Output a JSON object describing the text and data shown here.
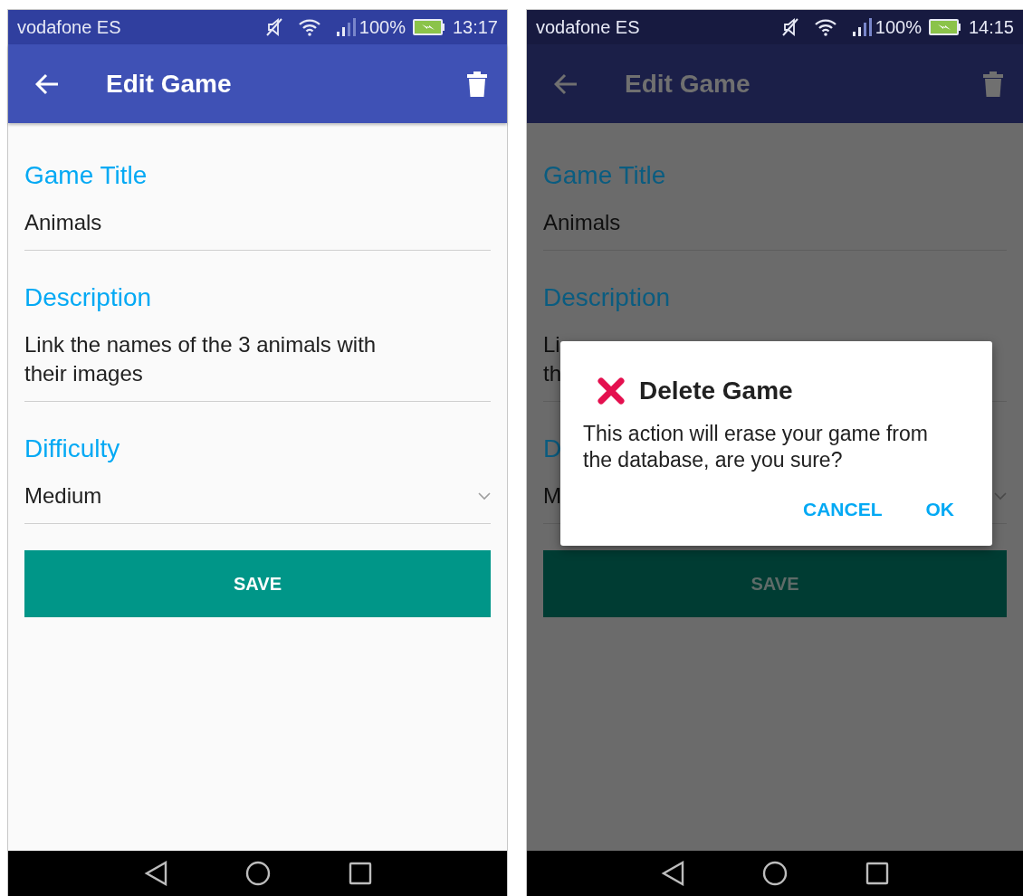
{
  "screens": [
    {
      "dimmed": false,
      "status_bar": {
        "carrier": "vodafone ES",
        "battery": "100%",
        "time": "13:17"
      },
      "app_bar": {
        "title": "Edit Game"
      },
      "fields": [
        {
          "kind": "text",
          "label": "Game Title",
          "lines": [
            "Animals"
          ]
        },
        {
          "kind": "text",
          "label": "Description",
          "lines": [
            "Link the names of the 3 animals with",
            "their images"
          ]
        },
        {
          "kind": "dropdown",
          "label": "Difficulty",
          "lines": [
            "Medium"
          ]
        }
      ],
      "save_button": "SAVE"
    },
    {
      "dimmed": true,
      "status_bar": {
        "carrier": "vodafone ES",
        "battery": "100%",
        "time": "14:15"
      },
      "app_bar": {
        "title": "Edit Game"
      },
      "fields": [
        {
          "kind": "text",
          "label": "Game Title",
          "lines": [
            "Animals"
          ]
        },
        {
          "kind": "text",
          "label": "Description",
          "lines": [
            "Li",
            "th"
          ]
        },
        {
          "kind": "dropdown",
          "label": "D",
          "lines": [
            "M"
          ]
        }
      ],
      "save_button": "SAVE",
      "dialog": {
        "title": "Delete Game",
        "message": "This action will erase your game from the database, are you sure?",
        "buttons": [
          "CANCEL",
          "OK"
        ]
      }
    }
  ]
}
